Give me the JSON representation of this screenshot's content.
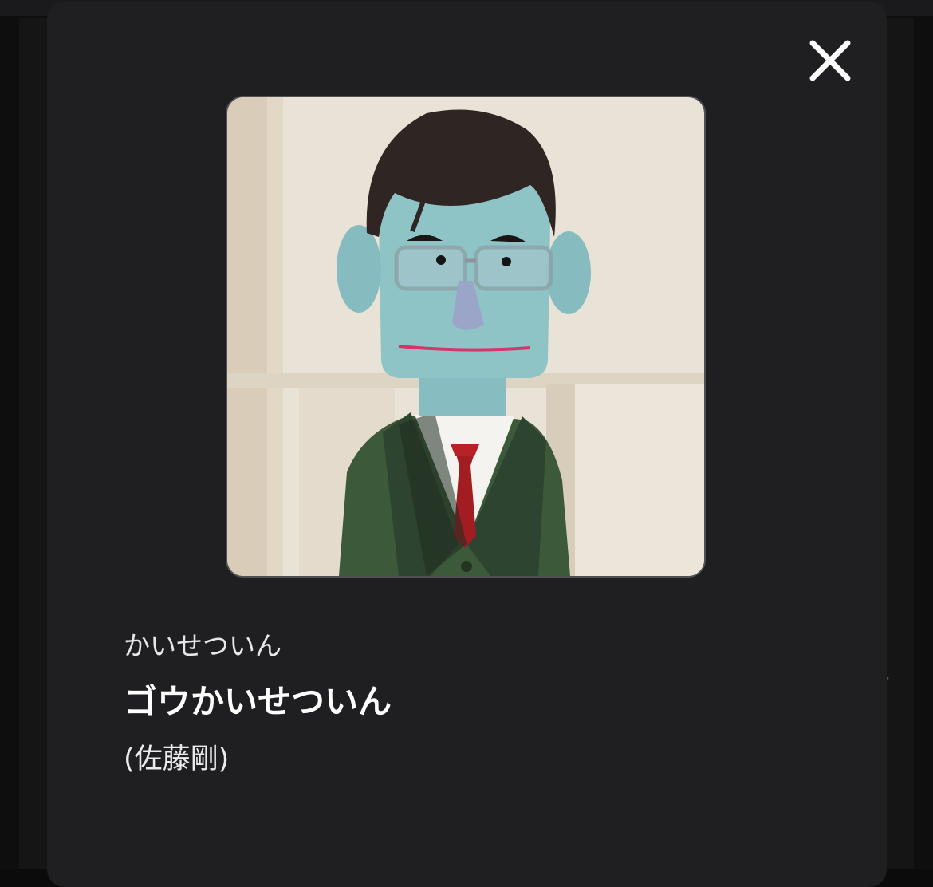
{
  "modal": {
    "close_icon": "close-icon",
    "portrait_alt": "ゴウかいせついん",
    "reading": "かいせついん",
    "name": "ゴウかいせついん",
    "actor": "(佐藤剛)"
  },
  "colors": {
    "modal_background": "#1f1f22",
    "page_background": "#0e0e0f",
    "text_primary": "#ffffff",
    "text_secondary": "#e8e8ea"
  }
}
